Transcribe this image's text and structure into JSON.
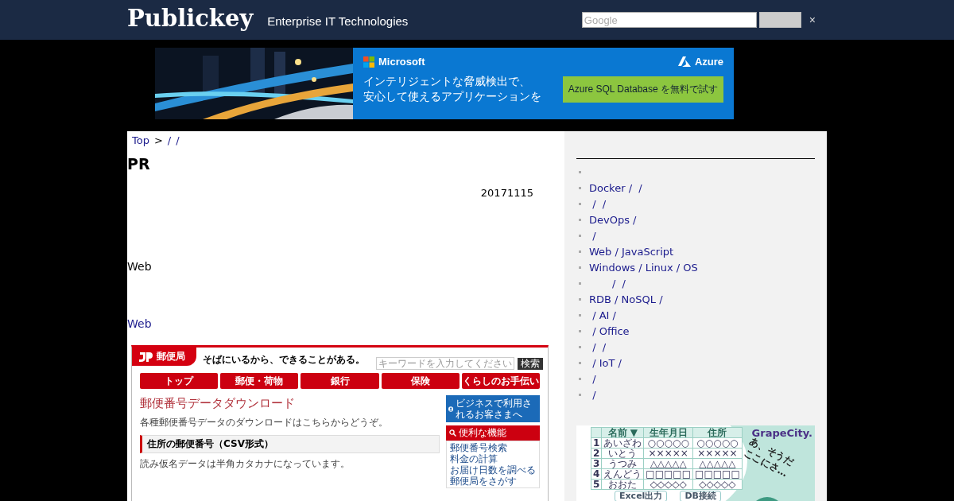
{
  "header": {
    "logo": "Publickey",
    "tagline": "Enterprise IT Technologies",
    "search": {
      "placeholder": "Google"
    },
    "close": "×"
  },
  "banner_ad": {
    "kind": "picture",
    "brand": "Microsoft",
    "product": "Azure",
    "headline": [
      "インテリジェントな脅威検出で、",
      "安心して使えるアプリケーションを"
    ],
    "cta": "Azure SQL Database を無料で試す"
  },
  "breadcrumb": [
    {
      "kind": "link",
      "label": "Top"
    },
    {
      "kind": "separator",
      "label": ">"
    },
    {
      "kind": "link",
      "label": "/"
    },
    {
      "kind": "link",
      "label": "/"
    }
  ],
  "article": {
    "title": "PR",
    "date": "20171115",
    "paragraphs": [
      {
        "kind": "text",
        "text": "Web"
      },
      {
        "kind": "link",
        "text": "Web"
      }
    ],
    "screenshot": {
      "site_name": "郵便局",
      "tagline": "そばにいるから、できることがある。",
      "search_placeholder": "キーワードを入力してください",
      "search_button": "検索",
      "nav": [
        "トップ",
        "郵便・荷物",
        "銀行",
        "保険",
        "くらしのお手伝い"
      ],
      "title": "郵便番号データダウンロード",
      "intro": "各種郵便番号データのダウンロードはこちらからどうぞ。",
      "section": "住所の郵便番号（CSV形式）",
      "note": "読み仮名データは半角カタカナになっています。",
      "business": "ビジネスで利用されるお客さまへ",
      "tools_title": "便利な機能",
      "tools": [
        "郵便番号検索",
        "料金の計算",
        "お届け日数を調べる",
        "郵便局をさがす"
      ]
    }
  },
  "sidebar": {
    "items": [
      {
        "kind": "blank"
      },
      {
        "kind": "link",
        "label": "Docker /  /"
      },
      {
        "kind": "link",
        "label": " /  /"
      },
      {
        "kind": "link",
        "label": "DevOps /"
      },
      {
        "kind": "link",
        "label": " /"
      },
      {
        "kind": "link",
        "label": "Web / JavaScript"
      },
      {
        "kind": "link",
        "label": "Windows / Linux / OS"
      },
      {
        "kind": "link",
        "label": "       /  /"
      },
      {
        "kind": "link",
        "label": "RDB / NoSQL /"
      },
      {
        "kind": "link",
        "label": " / AI /"
      },
      {
        "kind": "link",
        "label": " / Office"
      },
      {
        "kind": "link",
        "label": " /  /"
      },
      {
        "kind": "link",
        "label": " / IoT /"
      },
      {
        "kind": "link",
        "label": " /"
      },
      {
        "kind": "link",
        "label": " /"
      }
    ]
  },
  "sidebar_ad": {
    "logo": "GrapeCity.",
    "columns": [
      "",
      "名前 ▼",
      "生年月日",
      "住所"
    ],
    "rows": [
      [
        "1",
        "あいざわ",
        "○○○○○",
        "○○○○○"
      ],
      [
        "2",
        "いとう",
        "×××××",
        "×××××"
      ],
      [
        "3",
        "うつみ",
        "△△△△△",
        "△△△△△"
      ],
      [
        "4",
        "えんどう",
        "□□□□□",
        "□□□□□"
      ],
      [
        "5",
        "おおた",
        "◇◇◇◇◇",
        "◇◇◇◇◇"
      ]
    ],
    "buttons": [
      "Excel出力",
      "DB接続"
    ],
    "handwriting": [
      "あ、そうだ",
      "ここにさ…"
    ]
  }
}
